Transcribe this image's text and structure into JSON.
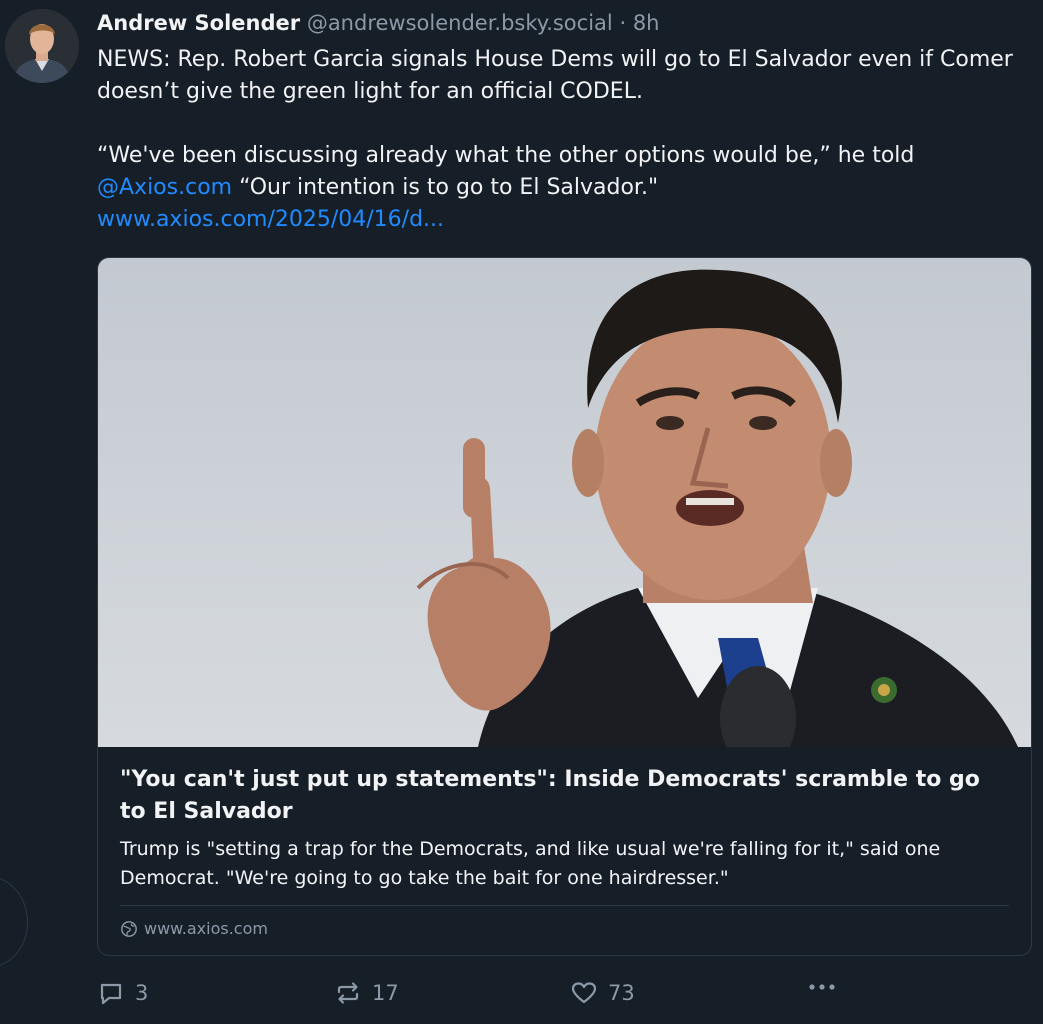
{
  "author": {
    "name": "Andrew Solender",
    "handle": "@andrewsolender.bsky.social",
    "separator": "·",
    "time": "8h"
  },
  "post": {
    "line1": "NEWS: Rep. Robert Garcia signals House Dems will go to El Salvador even if Comer doesn’t give the green light for an official CODEL.",
    "quote_start": "“We've been discussing already what the other options would be,” he told ",
    "mention": "@Axios.com",
    "quote_end": " “Our intention is to go to El Salvador.\"",
    "url": "www.axios.com/2025/04/16/d..."
  },
  "embed": {
    "title": "\"You can't just put up statements\": Inside Democrats' scramble to go to El Salvador",
    "description": "Trump is \"setting a trap for the Democrats, and like usual we're falling for it,\" said one Democrat. \"We're going to go take the bait for one hairdresser.\"",
    "domain": "www.axios.com",
    "image_subject": "man-pointing-finger-photo"
  },
  "actions": {
    "replies": "3",
    "reposts": "17",
    "likes": "73"
  },
  "colors": {
    "background": "#161e27",
    "link": "#208bfe",
    "muted": "#8b99a8",
    "border": "#2e3845"
  }
}
